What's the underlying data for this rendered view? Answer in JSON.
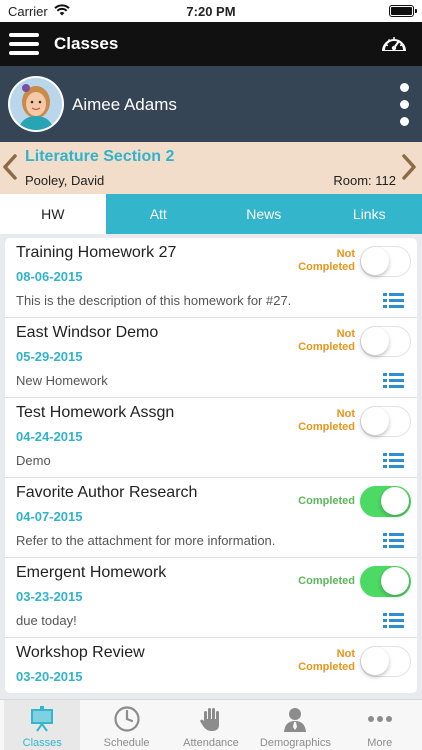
{
  "status_bar": {
    "carrier": "Carrier",
    "time": "7:20 PM"
  },
  "nav": {
    "title": "Classes"
  },
  "profile": {
    "name": "Aimee Adams"
  },
  "class_info": {
    "name": "Literature Section 2",
    "teacher": "Pooley, David",
    "room": "Room: 112"
  },
  "tabs": [
    {
      "label": "HW",
      "active": true
    },
    {
      "label": "Att",
      "active": false
    },
    {
      "label": "News",
      "active": false
    },
    {
      "label": "Links",
      "active": false
    }
  ],
  "homework": [
    {
      "title": "Training Homework 27",
      "date": "08-06-2015",
      "description": "This is the description of this homework for #27.",
      "status_line1": "Not",
      "status_line2": "Completed",
      "completed": false
    },
    {
      "title": "East Windsor Demo",
      "date": "05-29-2015",
      "description": "New Homework",
      "status_line1": "Not",
      "status_line2": "Completed",
      "completed": false
    },
    {
      "title": "Test Homework Assgn",
      "date": "04-24-2015",
      "description": "Demo",
      "status_line1": "Not",
      "status_line2": "Completed",
      "completed": false
    },
    {
      "title": "Favorite Author Research",
      "date": "04-07-2015",
      "description": "Refer to the attachment for more information.",
      "status_line1": "Completed",
      "status_line2": "",
      "completed": true
    },
    {
      "title": "Emergent Homework",
      "date": "03-23-2015",
      "description": "due today!",
      "status_line1": "Completed",
      "status_line2": "",
      "completed": true
    },
    {
      "title": "Workshop Review",
      "date": "03-20-2015",
      "description": "",
      "status_line1": "Not",
      "status_line2": "Completed",
      "completed": false
    }
  ],
  "colors": {
    "accent": "#33b5cc",
    "not_completed": "#e8951a",
    "completed": "#5cb85c",
    "toggle_on": "#4cd964"
  },
  "tabbar": [
    {
      "label": "Classes",
      "icon": "classes-icon",
      "active": true
    },
    {
      "label": "Schedule",
      "icon": "clock-icon",
      "active": false
    },
    {
      "label": "Attendance",
      "icon": "hand-icon",
      "active": false
    },
    {
      "label": "Demographics",
      "icon": "person-icon",
      "active": false
    },
    {
      "label": "More",
      "icon": "more-dots-icon",
      "active": false
    }
  ]
}
